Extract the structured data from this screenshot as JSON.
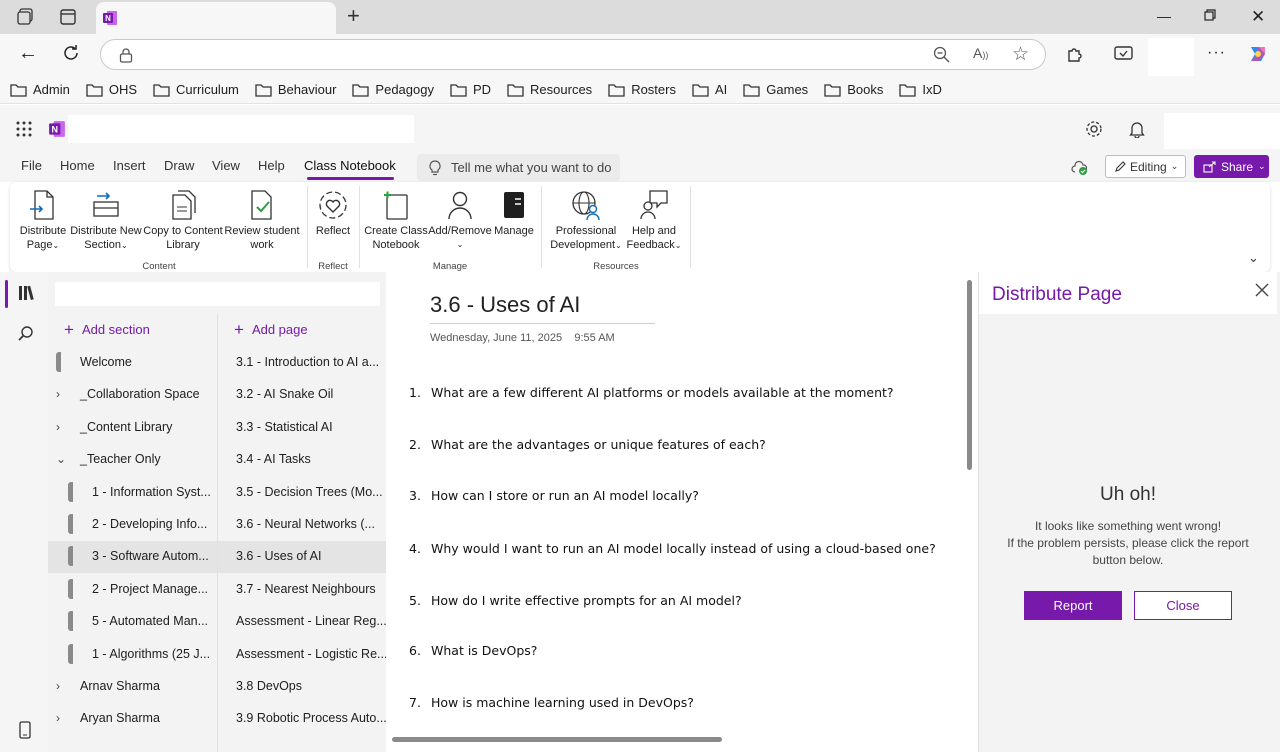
{
  "bookmarks": [
    "Admin",
    "OHS",
    "Curriculum",
    "Behaviour",
    "Pedagogy",
    "PD",
    "Resources",
    "Rosters",
    "AI",
    "Games",
    "Books",
    "IxD"
  ],
  "menu": {
    "file": "File",
    "home": "Home",
    "insert": "Insert",
    "draw": "Draw",
    "view": "View",
    "help": "Help",
    "class_notebook": "Class Notebook",
    "tell_me": "Tell me what you want to do",
    "editing": "Editing",
    "share": "Share"
  },
  "ribbon": {
    "distribute_page": [
      "Distribute",
      "Page"
    ],
    "distribute_section": [
      "Distribute New",
      "Section"
    ],
    "copy_content": [
      "Copy to Content",
      "Library"
    ],
    "review_work": [
      "Review student",
      "work"
    ],
    "reflect": "Reflect",
    "create_notebook": [
      "Create Class",
      "Notebook"
    ],
    "add_remove": "Add/Remove",
    "manage": "Manage",
    "prof_dev": [
      "Professional",
      "Development"
    ],
    "help_feedback": [
      "Help and",
      "Feedback"
    ],
    "groups": {
      "content": "Content",
      "reflect": "Reflect",
      "manage": "Manage",
      "resources": "Resources"
    }
  },
  "nav": {
    "add_section": "Add section",
    "add_page": "Add page",
    "sections": [
      {
        "label": "Welcome",
        "indent": 0,
        "chev": ""
      },
      {
        "label": "_Collaboration Space",
        "indent": 0,
        "chev": "›"
      },
      {
        "label": "_Content Library",
        "indent": 0,
        "chev": "›"
      },
      {
        "label": "_Teacher Only",
        "indent": 0,
        "chev": "⌄"
      },
      {
        "label": "1 - Information Syst...",
        "indent": 1,
        "chev": ""
      },
      {
        "label": "2 - Developing Info...",
        "indent": 1,
        "chev": ""
      },
      {
        "label": "3 - Software Autom...",
        "indent": 1,
        "chev": ""
      },
      {
        "label": "2 - Project Manage...",
        "indent": 1,
        "chev": ""
      },
      {
        "label": "5 - Automated Man...",
        "indent": 1,
        "chev": ""
      },
      {
        "label": "1 - Algorithms (25 J...",
        "indent": 1,
        "chev": ""
      },
      {
        "label": "Arnav Sharma",
        "indent": 0,
        "chev": "›"
      },
      {
        "label": "Aryan Sharma",
        "indent": 0,
        "chev": "›"
      }
    ],
    "pages": [
      "3.1 - Introduction to AI a...",
      "3.2 - AI Snake Oil",
      "3.3 - Statistical AI",
      "3.4 - AI Tasks",
      "3.5 - Decision Trees (Mo...",
      "3.6 - Neural Networks (...",
      "3.6 - Uses of AI",
      "3.7 - Nearest Neighbours",
      "Assessment - Linear Reg...",
      "Assessment - Logistic Re...",
      "3.8 DevOps",
      "3.9 Robotic Process Auto..."
    ]
  },
  "page": {
    "title": "3.6 - Uses of AI",
    "date": "Wednesday, June 11, 2025",
    "time": "9:55 AM",
    "questions": [
      "What are a few different AI platforms or models available at the moment?",
      "What are the advantages or unique features of each?",
      "How can I store or run an AI model locally?",
      "Why would I want to run an AI model locally instead of using a cloud-based one?",
      "How do I write effective prompts for an AI model?",
      "What is DevOps?",
      "How is machine learning used in DevOps?"
    ]
  },
  "pane": {
    "title": "Distribute Page",
    "heading": "Uh oh!",
    "message_1": "It looks like something went wrong!",
    "message_2": "If the problem persists, please click the report",
    "message_3": "button below.",
    "report": "Report",
    "close": "Close"
  },
  "colors": {
    "accent": "#7719aa",
    "bg": "#f3f3f3"
  }
}
